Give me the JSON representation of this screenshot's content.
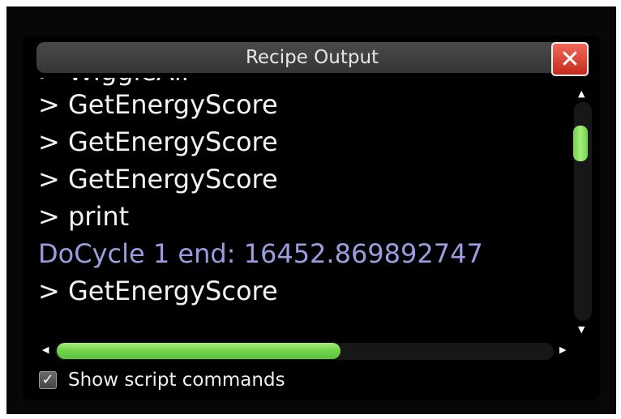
{
  "window": {
    "title": "Recipe Output",
    "close_icon": "close-x-icon",
    "close_glyph": "✕"
  },
  "log": {
    "lines": [
      {
        "text": "> WiggleAll",
        "kind": "command"
      },
      {
        "text": "> GetEnergyScore",
        "kind": "command"
      },
      {
        "text": "> GetEnergyScore",
        "kind": "command"
      },
      {
        "text": "> GetEnergyScore",
        "kind": "command"
      },
      {
        "text": "> print",
        "kind": "command"
      },
      {
        "text": "DoCycle 1 end: 16452.869892747",
        "kind": "output"
      },
      {
        "text": "> GetEnergyScore",
        "kind": "command"
      }
    ]
  },
  "scrollbars": {
    "up_glyph": "▲",
    "down_glyph": "▼",
    "left_glyph": "◀",
    "right_glyph": "▶"
  },
  "options": {
    "show_commands_label": "Show script commands",
    "show_commands_checked": true,
    "check_glyph": "✓"
  },
  "colors": {
    "accent_green": "#8fe05c",
    "output_text": "#9c9ce0",
    "command_text": "#f2f2f2",
    "close_red": "#d9402f"
  }
}
